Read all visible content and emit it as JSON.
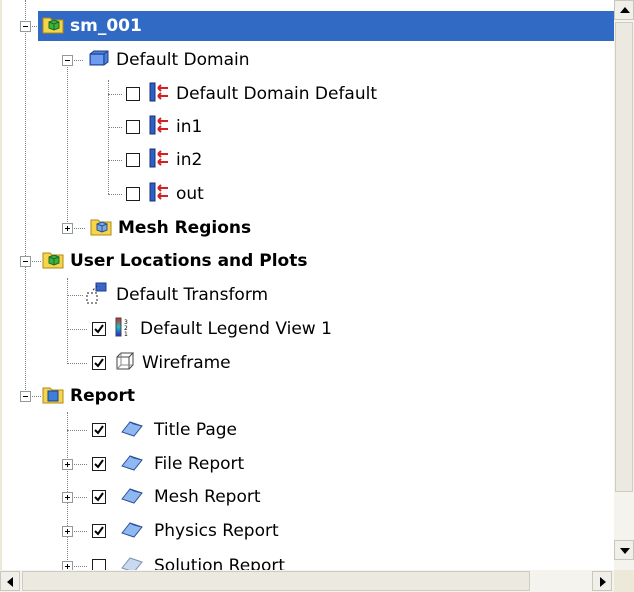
{
  "tree": {
    "sm_001": "sm_001",
    "default_domain": "Default Domain",
    "boundaries": [
      {
        "label": "Default Domain Default",
        "checked": false
      },
      {
        "label": "in1",
        "checked": false
      },
      {
        "label": "in2",
        "checked": false
      },
      {
        "label": "out",
        "checked": false
      }
    ],
    "mesh_regions": "Mesh Regions",
    "user_locations": "User Locations and Plots",
    "default_transform": "Default Transform",
    "default_legend": {
      "label": "Default Legend View 1",
      "checked": true
    },
    "wireframe": {
      "label": "Wireframe",
      "checked": true
    },
    "report": "Report",
    "report_items": [
      {
        "label": "Title Page",
        "checked": true
      },
      {
        "label": "File Report",
        "checked": true
      },
      {
        "label": "Mesh Report",
        "checked": true
      },
      {
        "label": "Physics Report",
        "checked": true
      },
      {
        "label": "Solution Report",
        "checked": false
      }
    ]
  },
  "colors": {
    "selection": "#316ac5",
    "folder": "#f5d54b",
    "boundary_blue": "#2f5ec8",
    "boundary_red": "#d42020"
  },
  "icons": {
    "model": "green-cube-folder-icon",
    "domain": "blue-box-icon",
    "boundary": "boundary-arrows-icon",
    "mesh": "mesh-folder-icon",
    "locations": "green-folder-icon",
    "transform": "transform-icon",
    "legend": "legend-icon",
    "wireframe": "wireframe-cube-icon",
    "report": "report-folder-icon",
    "report_page": "report-page-icon"
  }
}
